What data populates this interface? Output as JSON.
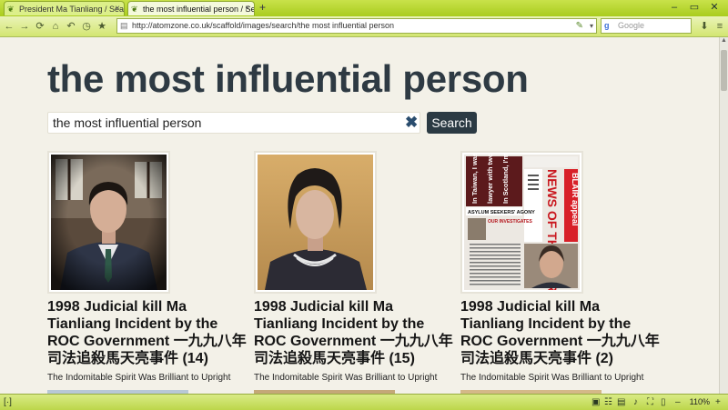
{
  "browser": {
    "tabs": [
      {
        "label": "President Ma Tianliang / Search ...",
        "active": false
      },
      {
        "label": "the most influential person / Se...",
        "active": true
      }
    ],
    "new_tab_label": "+",
    "url": "http://atomzone.co.uk/scaffold/images/search/the most influential person",
    "search_placeholder": "Google",
    "zoom": "110%",
    "accent": "#b6d632"
  },
  "page": {
    "title": "the most influential person",
    "search": {
      "value": "the most influential person",
      "button_label": "Search",
      "clear_symbol": "✖"
    },
    "results": [
      {
        "title": "1998 Judicial kill Ma Tianliang Incident by the ROC Government 一九九八年司法追殺馬天亮事件 (14)",
        "subtitle": "The Indomitable Spirit Was Brilliant to Upright"
      },
      {
        "title": "1998 Judicial kill Ma Tianliang Incident by the ROC Government 一九九八年司法追殺馬天亮事件 (15)",
        "subtitle": "The Indomitable Spirit Was Brilliant to Upright"
      },
      {
        "title": "1998 Judicial kill Ma Tianliang Incident by the ROC Government 一九九八年司法追殺馬天亮事件 (2)",
        "subtitle": "The Indomitable Spirit Was Brilliant to Upright"
      }
    ],
    "newspaper": {
      "headlines": [
        "In Taiwan, I was a rich",
        "lawyer with two homes.",
        "In Scotland, I'm spat on"
      ],
      "masthead": "NEWS OF THE WORLD",
      "banner": "ASYLUM SEEKERS' AGONY",
      "subhead": "OUR INVESTIGATES",
      "tagline": "BLAIR appeal"
    }
  }
}
